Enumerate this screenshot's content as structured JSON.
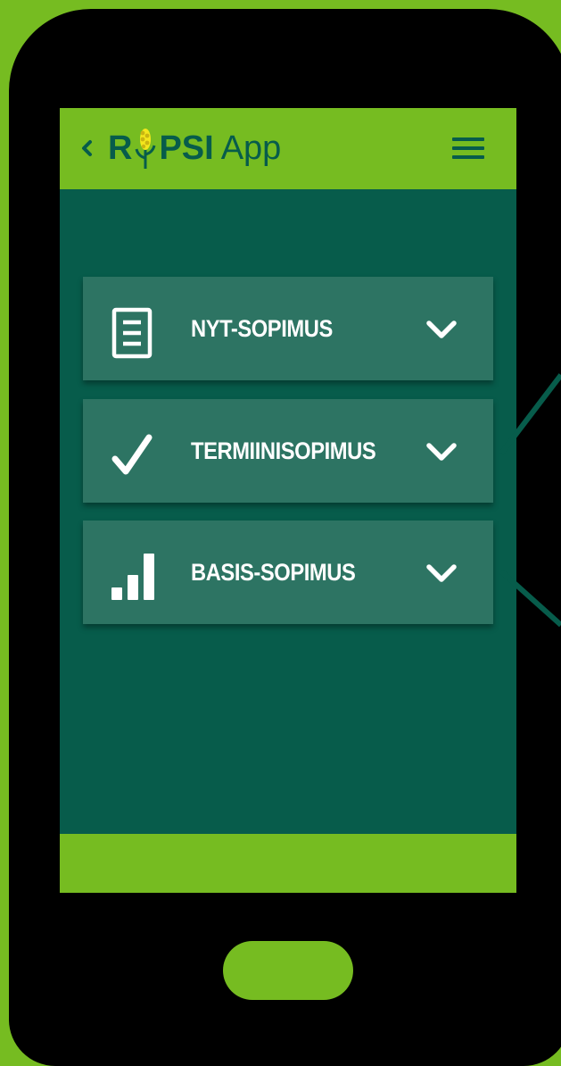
{
  "app": {
    "logo_part1": "R",
    "logo_part2": "PSI",
    "logo_suffix": "App",
    "back_icon": "chevron-left-icon",
    "menu_icon": "hamburger-menu-icon"
  },
  "colors": {
    "brand_green": "#76bc21",
    "screen_bg": "#075c4b",
    "card_bg": "#2d7463",
    "text": "#ffffff",
    "device": "#000000"
  },
  "contracts": [
    {
      "label": "NYT-SOPIMUS",
      "icon": "document-icon",
      "expand_icon": "chevron-down-icon"
    },
    {
      "label": "TERMIINISOPIMUS",
      "icon": "checkmark-icon",
      "expand_icon": "chevron-down-icon"
    },
    {
      "label": "BASIS-SOPIMUS",
      "icon": "bar-chart-icon",
      "expand_icon": "chevron-down-icon"
    }
  ]
}
